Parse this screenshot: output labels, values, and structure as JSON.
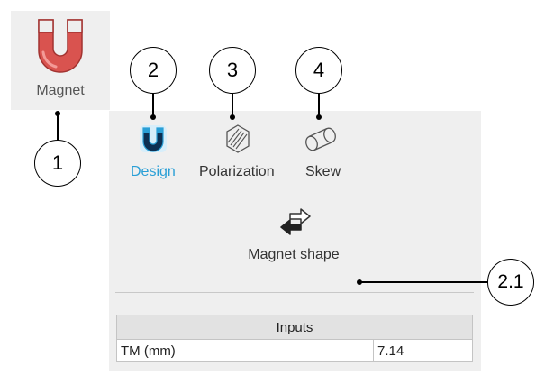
{
  "launcher": {
    "label": "Magnet",
    "icon": "horseshoe-magnet-icon"
  },
  "tabs": [
    {
      "label": "Design",
      "icon": "horseshoe-magnet-icon",
      "active": true,
      "color": "#2a9fd6"
    },
    {
      "label": "Polarization",
      "icon": "polarization-icon",
      "active": false
    },
    {
      "label": "Skew",
      "icon": "skew-cylinder-icon",
      "active": false
    }
  ],
  "design": {
    "shape_button_label": "Magnet shape",
    "shape_button_icon": "swap-arrows-icon"
  },
  "inputs_table": {
    "header": "Inputs",
    "rows": [
      {
        "name": "TM (mm)",
        "value": "7.14"
      }
    ]
  },
  "callouts": [
    "1",
    "2",
    "3",
    "4",
    "2.1"
  ],
  "colors": {
    "accent": "#2a9fd6",
    "magnet_red": "#d9534f",
    "panel_bg": "#efefef"
  }
}
